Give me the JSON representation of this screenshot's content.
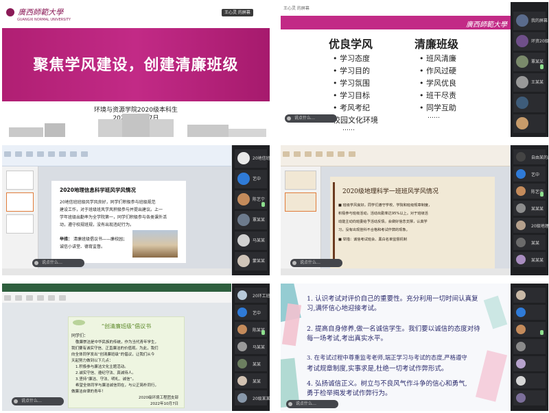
{
  "panel1": {
    "logo_text": "廣西師範大學",
    "logo_sub": "GUANGXI NORMAL UNIVERSITY",
    "presenter_label": "王心灵 的屏幕",
    "slide_title": "聚焦学风建设，创建清廉班级",
    "slide_subtitle": "环境与资源学院2020级本科生",
    "slide_date": "2022年10月7日",
    "colors": {
      "band": "#b8227a"
    }
  },
  "panel2": {
    "logo_text": "廣西師範大學",
    "presenter_label": "王心灵 的屏幕",
    "col1_title": "优良学风",
    "col1_items": [
      "• 学习态度",
      "• 学习目的",
      "• 学习氛围",
      "• 学习目标",
      "• 考风考纪",
      "• 校园文化环境",
      "……"
    ],
    "col2_title": "清廉班级",
    "col2_items": [
      "• 班风清廉",
      "• 作风过硬",
      "• 学风优良",
      "• 班干尽责",
      "• 同学互助",
      "……"
    ],
    "chat_hint": "说点什么…",
    "side_names": [
      "我的屏幕",
      "环资20级班主任",
      "覃某某",
      "王某某"
    ]
  },
  "panel3": {
    "heading": "2020地理信息科学班风学风情况",
    "body_lines": [
      "20地信班班级风学风良好，同学们积极参与班级规范",
      "建设工作，对于班级班风学风积极参与并提出建议。上一",
      "学年班级出勤率为全学院第一，同学们积极参与各类课外活",
      "动，遵守校规班规，没有出现违纪行为。"
    ],
    "motto_label": "举措：",
    "motto_lines": [
      "清廉班级倡议书——廉校园；",
      "诚信小讲堂、德育监督。"
    ],
    "chat_hint": "说点什么…",
    "side_names": [
      "20地信班的屏幕",
      "艺中",
      "陈艺宁",
      "覃某某",
      "马某某",
      "蒙某某"
    ]
  },
  "panel4": {
    "heading": "2020级地理科学一班班风学风情况",
    "body_lines": [
      "■ 班级学风良好，同学们遵守学校、学院和班级规章制度，",
      "积极参与班级活动，活动出勤率达95%以上。对于班级活",
      "动能主动向班委给予活动反馈。会做好信念支撑，认真学",
      "习，没有出现挂科不合格和考试作弊的现象。",
      "■ 举措：诚信考试班会、黑白名单监督机制"
    ],
    "chat_hint": "说点什么…",
    "side_names": [
      "自由某的屏幕共享",
      "艺中",
      "陈艺宁",
      "某某某",
      "20级地理某某某",
      "某某",
      "某某某"
    ]
  },
  "panel5": {
    "heading": "“创清廉班级”倡议书",
    "greeting": "同学们：",
    "body_lines": [
      "敬廉崇洁是中华民族的传统，作为当代青年学生，",
      "我们要有诚实守信、正直廉洁的价值观。为此，我们",
      "向全体同学发出“创清廉班级”的倡议，让我们从今",
      "天起努力做到以下几点：",
      "1.积极参与廉洁文化主题活动。",
      "2.诚实守信、遵纪守法、真诚待人。",
      "3.坚持“廉洁、守法、明礼、诚信”。",
      "希望全体同学与廉洁诚信同在，与公正简朴同行，",
      "做廉洁自律的青年！"
    ],
    "signature": "2020级环境工程团支部",
    "signature_date": "2022年10月7日",
    "chat_hint": "说点什么…",
    "side_names": [
      "20环工班长某某的屏幕",
      "艺中",
      "陈某某",
      "马某某",
      "某某",
      "某某",
      "20级某某某"
    ]
  },
  "panel6": {
    "lines": [
      "1. 认识考试对评价自己的重要性。充分利用一切时间认真复",
      "    习,满怀信心地迎接考试。",
      "2. 提高自身修养,做一名诚信学生。我们要以诚信的态度对待",
      "    每一场考试,考出真实水平。",
      "3. 在考试过程中尊重监考老师,端正学习与考试的态度,严格遵守",
      "    考试规章制度,实事求是,杜绝一切考试作弊形式。",
      "4. 弘扬诚信正义。树立与不良风气作斗争的信心和勇气,",
      "    勇于检举揭发考试作弊行为。"
    ],
    "chat_hint": "说点什么…"
  }
}
